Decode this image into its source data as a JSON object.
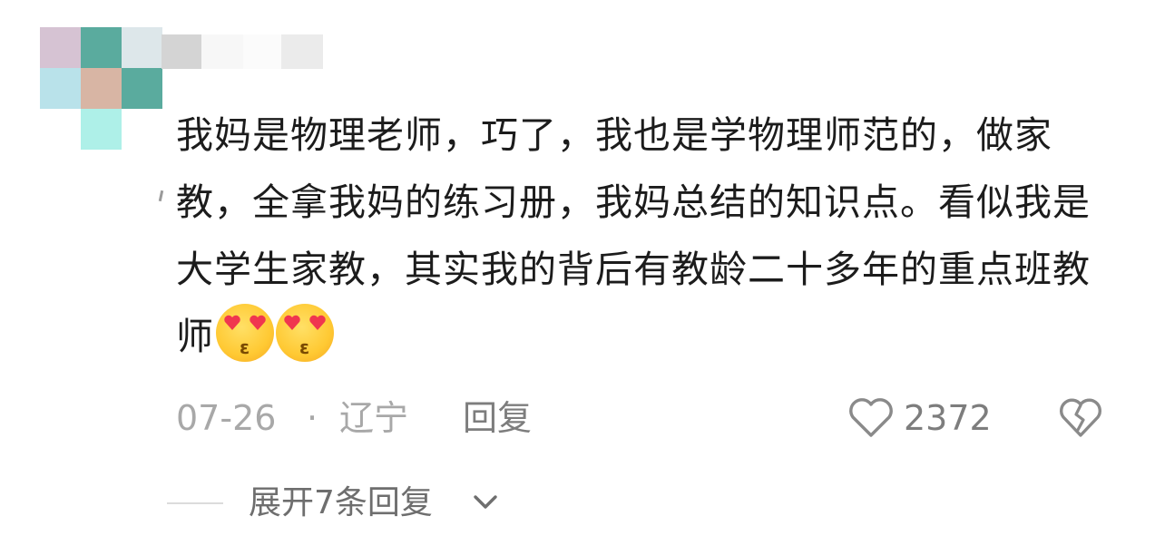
{
  "comment": {
    "text": "我妈是物理老师，巧了，我也是学物理师范的，做家教，全拿我妈的练习册，我妈总结的知识点。看似我是大学生家教，其实我的背后有教龄二十多年的重点班教师",
    "emoji": [
      "heart-eyes-kiss-emoji",
      "heart-eyes-kiss-emoji"
    ],
    "date": "07-26",
    "separator": "·",
    "location": "辽宁",
    "reply_label": "回复",
    "like_count": "2372"
  },
  "replies": {
    "expand_label": "展开7条回复"
  },
  "colors": {
    "text": "#1c1c1c",
    "meta": "#a8a8a8",
    "action": "#7d7d7d",
    "icon_stroke": "#8a8a8a",
    "heart_red": "#f0364f",
    "emoji_yellow": "#ffc933"
  },
  "icons": {
    "like": "heart-outline-icon",
    "dislike": "broken-heart-icon",
    "expand": "chevron-down-icon"
  }
}
